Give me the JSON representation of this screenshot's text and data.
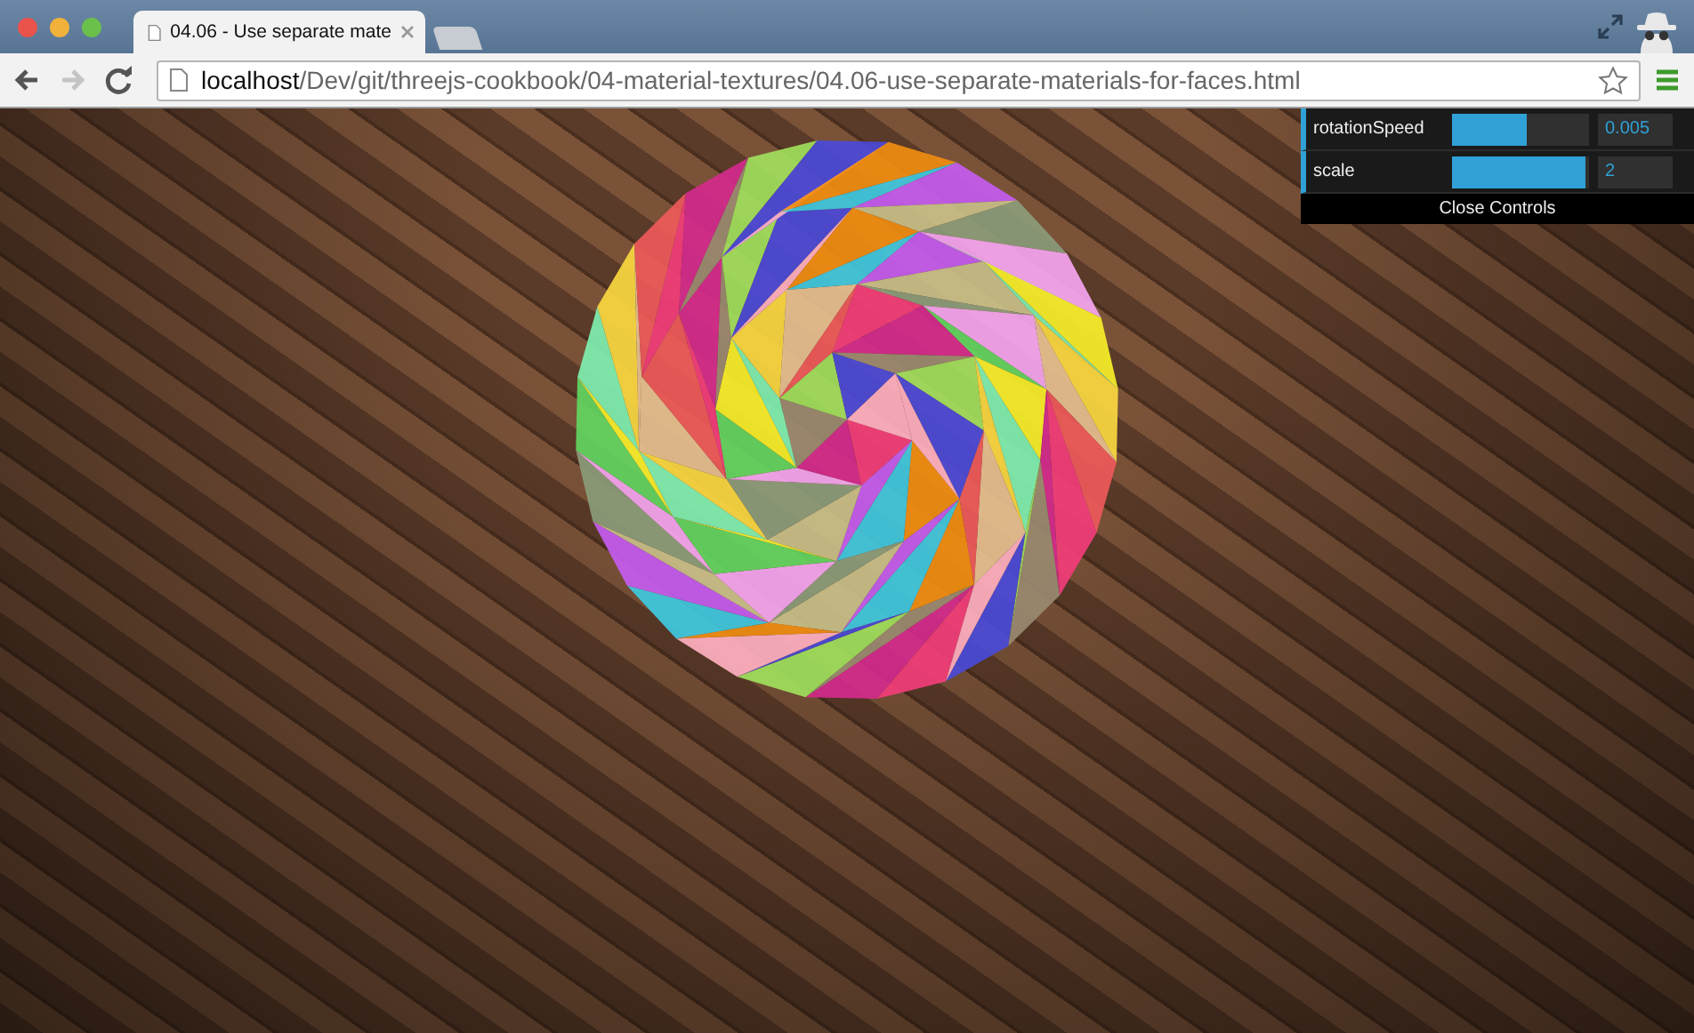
{
  "browser": {
    "tabs": [
      {
        "title": "04.06 - Use separate mate",
        "selected": true
      }
    ],
    "navigation": {
      "back_enabled": true,
      "forward_enabled": false
    },
    "address": "**localhost**/Dev/git/threejs-cookbook/04-material-textures/04.06-use-separate-materials-for-faces.html"
  },
  "controls": {
    "rows": [
      {
        "label": "rotationSpeed",
        "level": 0.55,
        "value": "0.005"
      },
      {
        "label": "scale",
        "level": 0.98,
        "value": "2"
      }
    ],
    "close_button": "Close Controls"
  }
}
